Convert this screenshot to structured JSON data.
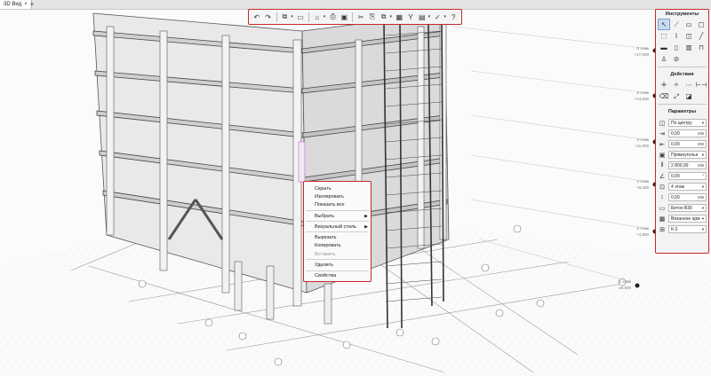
{
  "tab": {
    "title": "3D Вид",
    "close": "×",
    "add": "+"
  },
  "toolbar": {
    "buttons": [
      "↶",
      "↷",
      "⧉",
      "▭",
      "⌂",
      "⎙",
      "▣",
      "✂",
      "⎘",
      "⧉",
      "▦",
      "Y",
      "▤",
      "✓",
      "?"
    ]
  },
  "panel": {
    "tools_title": "Инструменты",
    "tools": [
      "↖",
      "⟋",
      "▭",
      "▢",
      "⬚",
      "⌇",
      "◫",
      "╱",
      "▬",
      "▯",
      "▥",
      "⊓",
      "♙",
      "⊘"
    ],
    "actions_title": "Действия",
    "actions": [
      "✛",
      "✧",
      "⋯",
      "⊢⊣",
      "⌫",
      "⤢",
      "◪"
    ],
    "params_title": "Параметры",
    "params": [
      {
        "icon": "◫",
        "value": "По центру",
        "unit": "",
        "dropdown": "▾"
      },
      {
        "icon": "⇥",
        "value": "0,00",
        "unit": "мм",
        "dropdown": ""
      },
      {
        "icon": "⇤",
        "value": "0,00",
        "unit": "мм",
        "dropdown": ""
      },
      {
        "icon": "▣",
        "value": "Прямоугольн",
        "unit": "",
        "dropdown": "▾"
      },
      {
        "icon": "‖",
        "value": "2 800,00",
        "unit": "мм",
        "dropdown": ""
      },
      {
        "icon": "∠",
        "value": "0,00",
        "unit": "°",
        "dropdown": ""
      },
      {
        "icon": "⊡",
        "value": "4 этаж",
        "unit": "",
        "dropdown": "▾"
      },
      {
        "icon": "↕",
        "value": "0,00",
        "unit": "мм",
        "dropdown": ""
      },
      {
        "icon": "▭",
        "value": "Бетон В30",
        "unit": "",
        "dropdown": "▾"
      },
      {
        "icon": "▦",
        "value": "Вязанное арм",
        "unit": "",
        "dropdown": "▾"
      },
      {
        "icon": "⊞",
        "value": "К-2",
        "unit": "",
        "dropdown": "▾"
      }
    ]
  },
  "context_menu": {
    "items": [
      {
        "label": "Скрыть",
        "sub": "",
        "disabled": false
      },
      {
        "label": "Изолировать",
        "sub": "",
        "disabled": false
      },
      {
        "label": "Показать все",
        "sub": "",
        "disabled": false
      },
      {
        "label": "Выбрать",
        "sub": "▶",
        "disabled": false
      },
      {
        "label": "Визуальный стиль",
        "sub": "▶",
        "disabled": false
      },
      {
        "label": "Вырезать",
        "sub": "",
        "disabled": false
      },
      {
        "label": "Копировать",
        "sub": "",
        "disabled": false
      },
      {
        "label": "Вставить",
        "sub": "",
        "disabled": true
      },
      {
        "label": "Удалить",
        "sub": "",
        "disabled": false
      },
      {
        "label": "Свойства",
        "sub": "",
        "disabled": false
      }
    ]
  },
  "levels": [
    {
      "name": "6 этаж",
      "elev": "+17,000"
    },
    {
      "name": "5 этаж",
      "elev": "+14,500"
    },
    {
      "name": "4 этаж",
      "elev": "+11,000"
    },
    {
      "name": "3 этаж",
      "elev": "+8,400"
    },
    {
      "name": "2 этаж",
      "elev": "+4,800"
    },
    {
      "name": "1 этаж",
      "elev": "±0,000"
    }
  ]
}
